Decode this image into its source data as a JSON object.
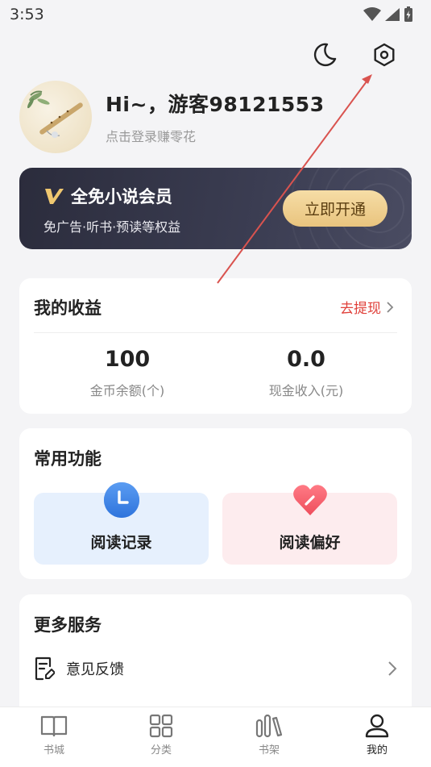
{
  "status_bar": {
    "time": "3:53"
  },
  "profile": {
    "greeting": "Hi~，游客98121553",
    "login_hint": "点击登录赚零花"
  },
  "vip": {
    "title": "全免小说会员",
    "subtitle": "免广告·听书·预读等权益",
    "button_label": "立即开通"
  },
  "earnings": {
    "title": "我的收益",
    "withdraw_label": "去提现",
    "coins_value": "100",
    "coins_label": "金币余额(个)",
    "cash_value": "0.0",
    "cash_label": "现金收入(元)"
  },
  "functions": {
    "title": "常用功能",
    "reading_history": "阅读记录",
    "reading_preference": "阅读偏好"
  },
  "services": {
    "title": "更多服务",
    "feedback": "意见反馈"
  },
  "tabbar": {
    "tabs": [
      {
        "label": "书城",
        "icon": "book-open-icon"
      },
      {
        "label": "分类",
        "icon": "grid-icon"
      },
      {
        "label": "书架",
        "icon": "bookshelf-icon"
      },
      {
        "label": "我的",
        "icon": "person-icon"
      }
    ],
    "active": "我的"
  },
  "colors": {
    "accent_red": "#e0403a",
    "vip_gold": "#e9c47e",
    "vip_dark": "#2b2c3c",
    "history_tile": "#e6f0fd",
    "preference_tile": "#fdecee"
  }
}
